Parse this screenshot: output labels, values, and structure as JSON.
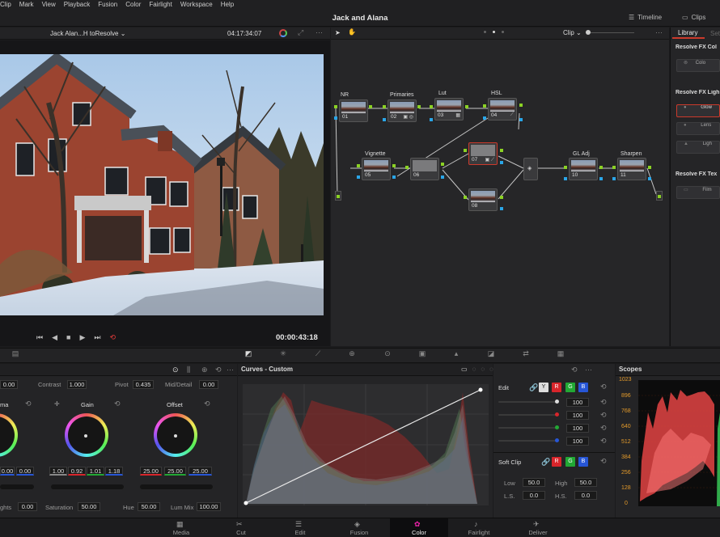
{
  "menu": [
    "Clip",
    "Mark",
    "View",
    "Playback",
    "Fusion",
    "Color",
    "Fairlight",
    "Workspace",
    "Help"
  ],
  "project_title": "Jack and Alana",
  "header_buttons": {
    "timeline": "Timeline",
    "clips": "Clips"
  },
  "viewer": {
    "clip_name": "Jack  Alan...H toResolve",
    "clip_timecode": "04:17:34:07",
    "playhead_timecode": "00:00:43:18"
  },
  "node_editor": {
    "mode_label": "Clip"
  },
  "nodes": [
    {
      "label": "NR",
      "num": "01",
      "icon": ""
    },
    {
      "label": "Primaries",
      "num": "02",
      "icon": "▣ ◎"
    },
    {
      "label": "Lut",
      "num": "03",
      "icon": "▦"
    },
    {
      "label": "HSL",
      "num": "04",
      "icon": "⟋"
    },
    {
      "label": "Vignette",
      "num": "05",
      "icon": ""
    },
    {
      "label": "",
      "num": "06",
      "icon": ""
    },
    {
      "label": "",
      "num": "07",
      "icon": "▣ ⟋"
    },
    {
      "label": "",
      "num": "08",
      "icon": ""
    },
    {
      "label": "GL Adj",
      "num": "10",
      "icon": ""
    },
    {
      "label": "Sharpen",
      "num": "11",
      "icon": ""
    }
  ],
  "library": {
    "tab_active": "Library",
    "tab_other": "Set",
    "groups": [
      {
        "title": "Resolve FX Col",
        "items": [
          "Colo"
        ]
      },
      {
        "title": "Resolve FX Ligh",
        "items": [
          "Glow",
          "Lens",
          "Ligh"
        ]
      },
      {
        "title": "Resolve FX Tex",
        "items": [
          "Film"
        ]
      }
    ]
  },
  "primaries": {
    "top": {
      "first_val": "0.00",
      "contrast_label": "Contrast",
      "contrast": "1.000",
      "pivot_label": "Pivot",
      "pivot": "0.435",
      "middetail_label": "Mid/Detail",
      "middetail": "0.00"
    },
    "wheels": [
      {
        "name": "ma",
        "values": [
          "0.00",
          "0.00"
        ]
      },
      {
        "name": "Gain",
        "values": [
          "1.00",
          "0.92",
          "1.01",
          "1.18"
        ]
      },
      {
        "name": "Offset",
        "values": [
          "25.00",
          "25.00",
          "25.00"
        ]
      }
    ],
    "bottom": {
      "hl_label": "ghts",
      "hl": "0.00",
      "sat_label": "Saturation",
      "sat": "50.00",
      "hue_label": "Hue",
      "hue": "50.00",
      "lummix_label": "Lum Mix",
      "lummix": "100.00"
    }
  },
  "curves": {
    "title": "Curves - Custom"
  },
  "edit": {
    "title": "Edit",
    "channel_values": [
      "100",
      "100",
      "100",
      "100"
    ],
    "softclip_title": "Soft Clip",
    "low_label": "Low",
    "low": "50.0",
    "high_label": "High",
    "high": "50.0",
    "ls_label": "L.S.",
    "ls": "0.0",
    "hs_label": "H.S.",
    "hs": "0.0"
  },
  "scopes": {
    "title": "Scopes",
    "scale": [
      "1023",
      "896",
      "768",
      "640",
      "512",
      "384",
      "256",
      "128",
      "0"
    ]
  },
  "pages": [
    {
      "label": "Media",
      "icon": "▦"
    },
    {
      "label": "Cut",
      "icon": "✂"
    },
    {
      "label": "Edit",
      "icon": "☰"
    },
    {
      "label": "Fusion",
      "icon": "◈"
    },
    {
      "label": "Color",
      "icon": "✿"
    },
    {
      "label": "Fairlight",
      "icon": "♪"
    },
    {
      "label": "Deliver",
      "icon": "✈"
    }
  ],
  "colors": {
    "green_pin": "#8bd224",
    "blue_pin": "#2aa6e8",
    "red": "#d8252b",
    "green": "#22a834",
    "blue": "#2756d6",
    "accent_selected": "#cc3a2c"
  }
}
